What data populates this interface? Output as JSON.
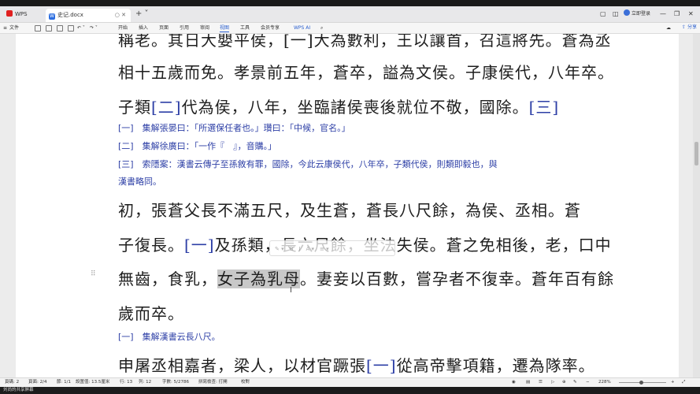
{
  "tabs": {
    "app": "WPS Office",
    "doc": "史记.docx"
  },
  "window": {
    "login": "立即登录"
  },
  "menu": {
    "items": [
      "文件",
      "开始",
      "插入",
      "页面",
      "引用",
      "审阅",
      "视图",
      "工具",
      "会员专享",
      "WPS AI"
    ],
    "active": "视图",
    "share": "分享"
  },
  "document": {
    "line1": "稱老。其日大嬰平侯，[一]大為數利，王以讓首，召這將先。蒼為丞",
    "line2": "相十五歲而免。孝景前五年，蒼卒，謚為文侯。子康侯代，八年卒。",
    "line3a": "子類",
    "line3ref": "[二]",
    "line3b": "代為侯，八年，坐臨諸侯喪後就位不敬，國除。",
    "line3ref2": "[三]",
    "note1": "[一]　集解張晏曰：「所選保任者也。」瓚曰：「中候，官名。」",
    "note2": "[二]　集解徐廣曰：「一作『　』，音購。」",
    "note3a": "[三]　索隱案：漢書云傳子至孫敘有罪，國除，今此云康侯代，八年卒，子類代侯，則類即毅也，與",
    "note3b": "漢書略同。",
    "line4": "初，張蒼父長不滿五尺，及生蒼，蒼長八尺餘，為侯、丞相。蒼",
    "line5a": "子復長。",
    "line5ref": "[一]",
    "line5b": "及孫類，長六尺餘，坐法失侯。蒼之免相後，老，口中",
    "line6a": "無齒，食乳，",
    "line6hl": "女子為乳母",
    "line6b": "。妻妾以百數，嘗孕者不復幸。蒼年百有餘",
    "line7": "歲而卒。",
    "note4": "[一]　集解漢書云長八尺。",
    "line8a": "申屠丞相嘉者，梁人，以材官蹶張",
    "line8ref": "[一]",
    "line8b": "從高帝擊項籍，遷為隊率。"
  },
  "status": {
    "page": "頁碼: 2",
    "pages": "頁面: 2/4",
    "section": "節: 1/1",
    "setting": "設置值: 13.5厘米",
    "row": "行: 13",
    "col": "列: 12",
    "words": "字數: 5/2786",
    "spell": "拼寫檢查: 打開",
    "proof": "校對",
    "zoom": "228%"
  },
  "taskbar": {
    "text": "刘尚的共享屏幕"
  }
}
